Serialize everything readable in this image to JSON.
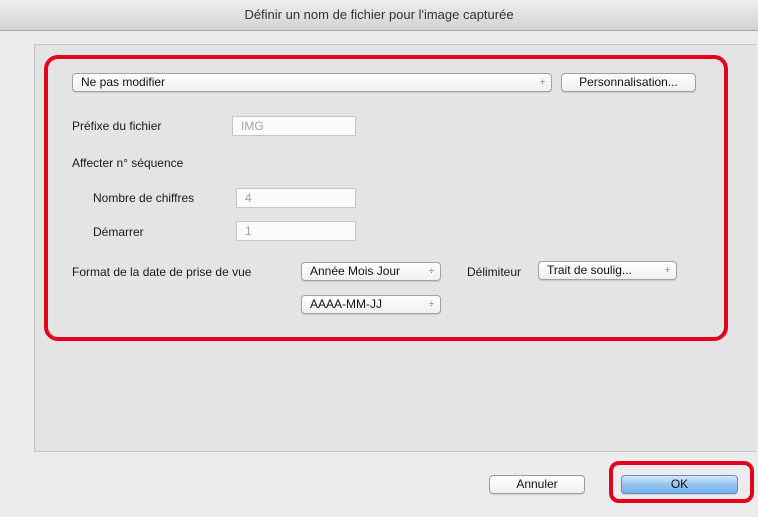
{
  "window": {
    "title": "Définir un nom de fichier pour l'image capturée"
  },
  "preset": {
    "selected": "Ne pas modifier"
  },
  "buttons": {
    "customize": "Personnalisation...",
    "cancel": "Annuler",
    "ok": "OK"
  },
  "prefix": {
    "label": "Préfixe du fichier",
    "value": "IMG"
  },
  "sequence": {
    "heading": "Affecter n° séquence",
    "digits_label": "Nombre de chiffres",
    "digits_value": "4",
    "start_label": "Démarrer",
    "start_value": "1"
  },
  "date_format": {
    "label": "Format de la date de prise de vue",
    "order_selected": "Année Mois Jour",
    "pattern_selected": "AAAA-MM-JJ"
  },
  "delimiter": {
    "label": "Délimiteur",
    "selected": "Trait de soulig..."
  },
  "icons": {
    "popup_arrows": "⌃⌄",
    "popup_arrows_glyph": "÷"
  },
  "colors": {
    "highlight": "#e4001c",
    "primary_button": "#8fc0ee"
  }
}
